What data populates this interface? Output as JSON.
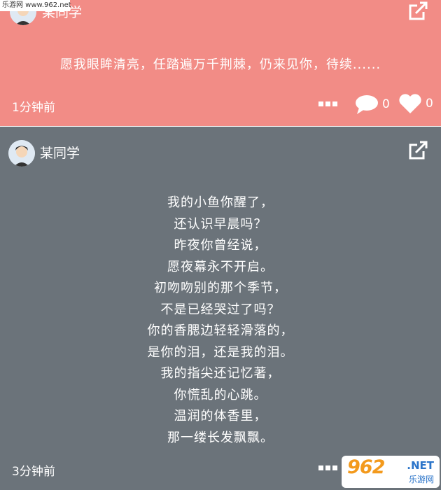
{
  "watermark_text": "乐游网 www.962.net",
  "posts": [
    {
      "author": "某同学",
      "text": "愿我眼眸清亮，任踏遍万千荆棘，仍来见你，待续......",
      "time": "1分钟前",
      "comments": "0",
      "likes": "0",
      "bg_color": "#f28c86"
    },
    {
      "author": "某同学",
      "poem_lines": [
        "我的小鱼你醒了，",
        "还认识早晨吗？",
        "昨夜你曾经说，",
        "愿夜幕永不开启。",
        "初吻吻别的那个季节，",
        "不是已经哭过了吗？",
        "你的香腮边轻轻滑落的，",
        "是你的泪，还是我的泪。",
        "我的指尖还记忆著，",
        "你慌乱的心跳。",
        "温润的体香里，",
        "那一缕长发飘飘。"
      ],
      "time": "3分钟前",
      "bg_color": "#6b737a"
    }
  ],
  "brand": {
    "number": "962",
    "net": ".NET",
    "cn": "乐游网"
  },
  "icons": [
    "avatar-icon",
    "share-icon",
    "more-icon",
    "comment-icon",
    "heart-icon"
  ]
}
